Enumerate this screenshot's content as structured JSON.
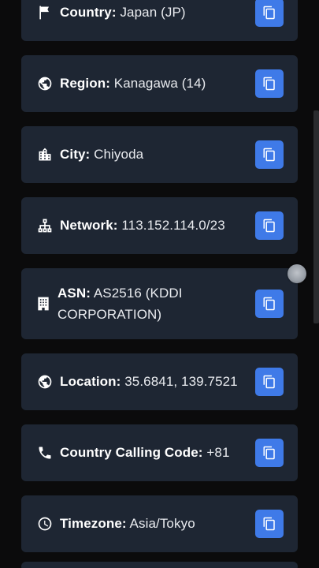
{
  "rows": [
    {
      "label": "Country:",
      "value": " Japan (JP)",
      "icon": "flag-icon"
    },
    {
      "label": "Region:",
      "value": " Kanagawa (14)",
      "icon": "globe-icon"
    },
    {
      "label": "City:",
      "value": " Chiyoda",
      "icon": "city-icon"
    },
    {
      "label": "Network:",
      "value": " 113.152.114.0/23",
      "icon": "network-icon"
    },
    {
      "label": "ASN:",
      "value": " AS2516 (KDDI CORPORATION)",
      "icon": "building-icon"
    },
    {
      "label": "Location:",
      "value": " 35.6841, 139.7521",
      "icon": "globe-icon"
    },
    {
      "label": "Country Calling Code:",
      "value": " +81",
      "icon": "phone-icon"
    },
    {
      "label": "Timezone:",
      "value": " Asia/Tokyo",
      "icon": "clock-icon"
    }
  ],
  "colors": {
    "background": "#0b0b0c",
    "card": "#1e2633",
    "accent": "#3f7ae8",
    "text": "#e9ebef"
  }
}
